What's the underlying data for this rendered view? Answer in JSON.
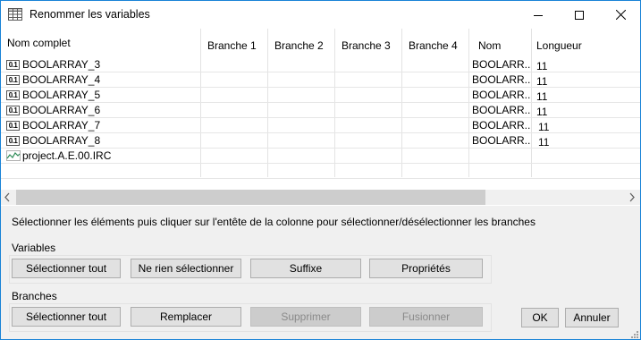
{
  "window": {
    "title": "Renommer les variables"
  },
  "grid": {
    "columns": [
      "Nom complet",
      "Branche 1",
      "Branche 2",
      "Branche 3",
      "Branche 4",
      "Nom",
      "Longueur"
    ],
    "rows": [
      {
        "icon": "bool-type-icon",
        "icon_text": "0.1",
        "full_name": "BOOLARRAY_3",
        "name": "BOOLARR...",
        "length": "11"
      },
      {
        "icon": "bool-type-icon",
        "icon_text": "0.1",
        "full_name": "BOOLARRAY_4",
        "name": "BOOLARR...",
        "length": "11"
      },
      {
        "icon": "bool-type-icon",
        "icon_text": "0.1",
        "full_name": "BOOLARRAY_5",
        "name": "BOOLARR...",
        "length": "11"
      },
      {
        "icon": "bool-type-icon",
        "icon_text": "0.1",
        "full_name": "BOOLARRAY_6",
        "name": "BOOLARR...",
        "length": "11"
      },
      {
        "icon": "bool-type-icon",
        "icon_text": "0.1",
        "full_name": "BOOLARRAY_7",
        "name": "BOOLARR...",
        "length": "11"
      },
      {
        "icon": "bool-type-icon",
        "icon_text": "0.1",
        "full_name": "BOOLARRAY_8",
        "name": "BOOLARR...",
        "length": "11"
      },
      {
        "icon": "analog-wave-icon",
        "icon_text": "",
        "full_name": "project.A.E.00.IRC",
        "name": "",
        "length": ""
      }
    ]
  },
  "instruction": "Sélectionner les éléments puis cliquer sur l'entête de la colonne pour sélectionner/désélectionner les branches",
  "variables_group": {
    "label": "Variables",
    "select_all": "Sélectionner tout",
    "select_none": "Ne rien sélectionner",
    "suffix": "Suffixe",
    "properties": "Propriétés"
  },
  "branches_group": {
    "label": "Branches",
    "select_all": "Sélectionner tout",
    "replace": "Remplacer",
    "delete": "Supprimer",
    "merge": "Fusionner"
  },
  "dialog": {
    "ok": "OK",
    "cancel": "Annuler"
  }
}
